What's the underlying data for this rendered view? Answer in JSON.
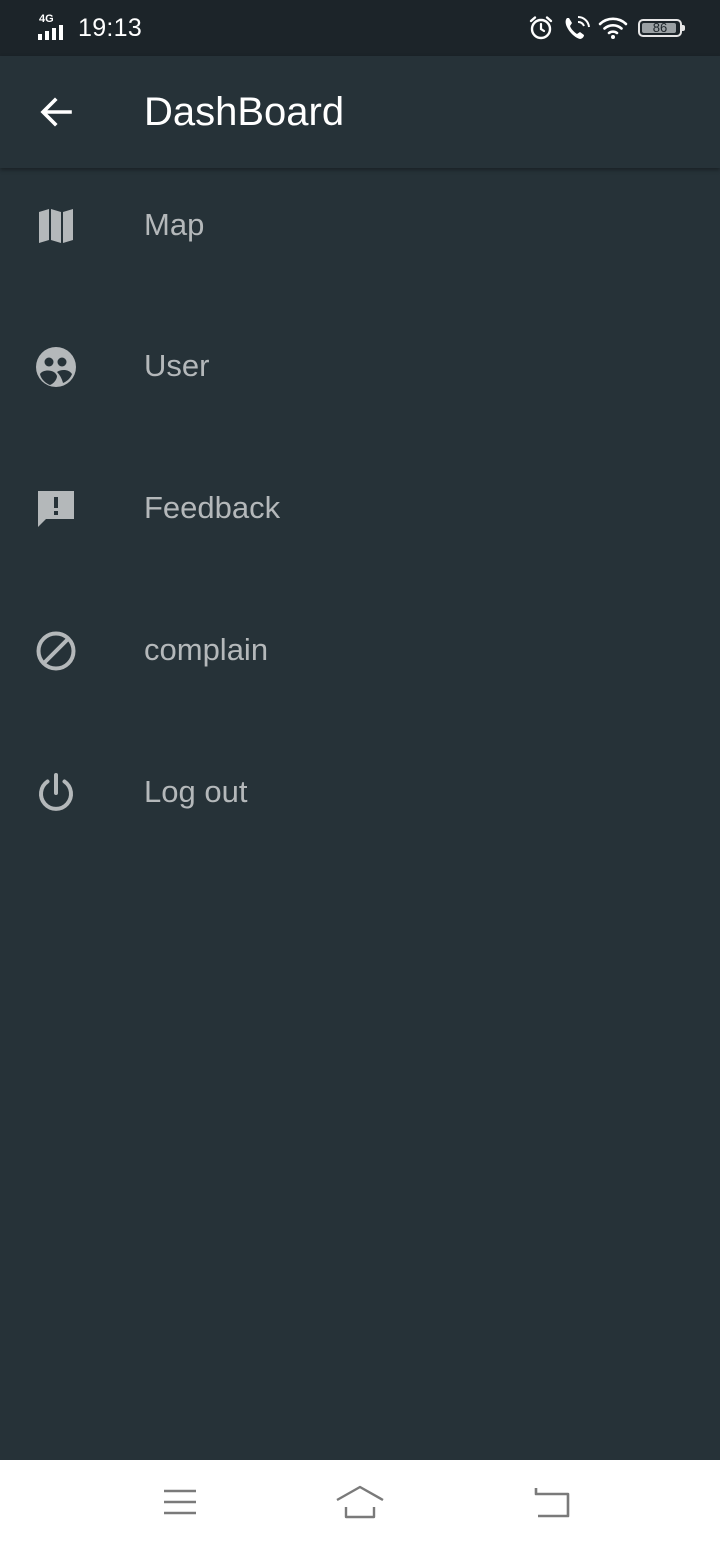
{
  "status_bar": {
    "network_type": "4G",
    "time": "19:13",
    "battery_level": "86",
    "icons": [
      "alarm-icon",
      "wifi-calling-icon",
      "wifi-icon",
      "battery-icon"
    ]
  },
  "app_bar": {
    "back_icon": "arrow-back-icon",
    "title": "DashBoard"
  },
  "menu": {
    "items": [
      {
        "label": "Map",
        "icon": "map-icon"
      },
      {
        "label": "User",
        "icon": "user-group-icon"
      },
      {
        "label": "Feedback",
        "icon": "feedback-icon"
      },
      {
        "label": "complain",
        "icon": "block-icon"
      },
      {
        "label": "Log out",
        "icon": "power-icon"
      }
    ]
  },
  "nav_bar": {
    "buttons": [
      "menu-icon",
      "home-icon",
      "back-icon"
    ]
  },
  "colors": {
    "background": "#263238",
    "status_bar": "#1c2429",
    "menu_text": "#b4b8ba",
    "title_text": "#ffffff",
    "nav_bar": "#ffffff"
  }
}
